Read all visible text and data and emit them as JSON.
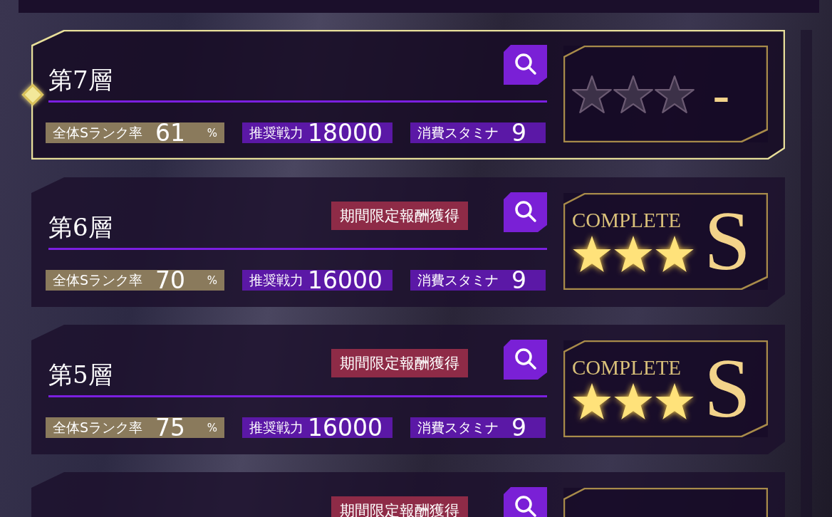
{
  "floors": [
    {
      "title": "第7層",
      "selected": true,
      "stats": [
        {
          "kind": "rate",
          "label": "全体Sランク率",
          "value": "61",
          "unit": "%"
        },
        {
          "kind": "power",
          "label": "推奨戦力",
          "value": "18000"
        },
        {
          "kind": "stamina",
          "label": "消費スタミナ",
          "value": "9"
        }
      ],
      "result": {
        "stars": 0,
        "rank": "-"
      }
    },
    {
      "title": "第6層",
      "selected": false,
      "reward_badge": "期間限定報酬獲得",
      "stats": [
        {
          "kind": "rate",
          "label": "全体Sランク率",
          "value": "70",
          "unit": "%"
        },
        {
          "kind": "power",
          "label": "推奨戦力",
          "value": "16000"
        },
        {
          "kind": "stamina",
          "label": "消費スタミナ",
          "value": "9"
        }
      ],
      "result": {
        "complete_label": "COMPLETE",
        "stars": 3,
        "rank": "S"
      }
    },
    {
      "title": "第5層",
      "selected": false,
      "reward_badge": "期間限定報酬獲得",
      "stats": [
        {
          "kind": "rate",
          "label": "全体Sランク率",
          "value": "75",
          "unit": "%"
        },
        {
          "kind": "power",
          "label": "推奨戦力",
          "value": "16000"
        },
        {
          "kind": "stamina",
          "label": "消費スタミナ",
          "value": "9"
        }
      ],
      "result": {
        "complete_label": "COMPLETE",
        "stars": 3,
        "rank": "S"
      }
    },
    {
      "selected": false,
      "reward_badge": "期間限定報酬獲得"
    }
  ]
}
